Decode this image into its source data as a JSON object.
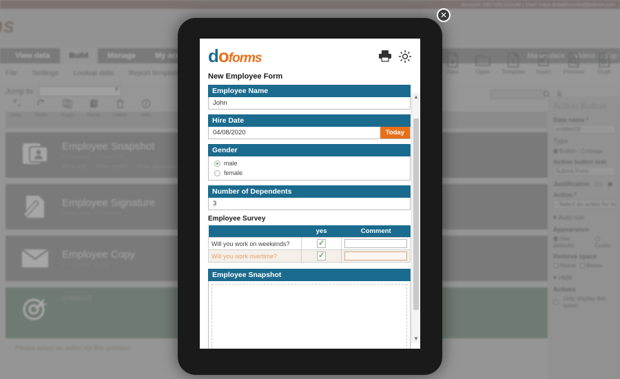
{
  "topbar": {
    "text": "Account  e807ofic102cd6   | User   maja.dutadinovska@yahoo.com"
  },
  "brand": {
    "logo_text": "ms"
  },
  "nav": {
    "tabs": [
      {
        "label": "View data",
        "active": false
      },
      {
        "label": "Build",
        "active": true
      },
      {
        "label": "Manage",
        "active": false
      },
      {
        "label": "My account",
        "active": false
      }
    ],
    "right_links": [
      "Marketplace",
      "Videos",
      "Sup"
    ]
  },
  "menubar": {
    "items": [
      "File",
      "Settings",
      "Lookup data",
      "Report templates"
    ]
  },
  "toolbar": {
    "items": [
      {
        "label": "New",
        "icon": "new-file-icon"
      },
      {
        "label": "Open",
        "icon": "folder-open-icon"
      },
      {
        "label": "Template",
        "icon": "template-icon"
      },
      {
        "label": "Insert",
        "icon": "insert-icon"
      },
      {
        "label": "Preview",
        "icon": "preview-icon"
      },
      {
        "label": "Draft",
        "icon": "draft-icon"
      }
    ]
  },
  "jumpbar": {
    "label": "Jump to",
    "select_value": "",
    "actions": [
      {
        "label": "Undo",
        "icon": "undo-icon"
      },
      {
        "label": "Redo",
        "icon": "redo-icon"
      },
      {
        "label": "Copy",
        "icon": "copy-icon"
      },
      {
        "label": "Paste",
        "icon": "paste-icon"
      },
      {
        "label": "Delete",
        "icon": "trash-icon"
      },
      {
        "label": "Help",
        "icon": "info-icon"
      }
    ],
    "search_placeholder": ""
  },
  "questions": [
    {
      "title": "Employee Snapshot",
      "subtitle": "Employee_Snapshot",
      "options": [
        "Allow edit",
        "Allow sketch",
        "Show advanced toolbar"
      ],
      "icon": "photo-id-icon",
      "selected": false
    },
    {
      "title": "Employee Signature",
      "subtitle": "Employee_Signature",
      "options": [],
      "icon": "signature-icon",
      "selected": false
    },
    {
      "title": "Employee Copy",
      "subtitle": "Employee_Copy",
      "options": [],
      "icon": "envelope-icon",
      "selected": false
    },
    {
      "title": "untitled15",
      "subtitle": "",
      "options": [],
      "icon": "target-action-icon",
      "selected": true
    }
  ],
  "warning": "Please select an action for this question",
  "row_controls": [
    "move-up-icon",
    "move-down-icon",
    "copy-icon",
    "delete-icon"
  ],
  "properties": {
    "title": "Action Button",
    "data_name_label": "Data name *",
    "data_name_value": "untitled15",
    "type_label": "Type",
    "type_options": [
      "Button",
      "Image"
    ],
    "type_selected": "Button",
    "action_text_label": "Action button text",
    "action_text_value": "Submit Form",
    "justification_label": "Justification",
    "justification_options": [
      "L",
      "C"
    ],
    "action_label": "Action *",
    "action_value": "- Select an action for bu",
    "auto_run_label": "Auto run",
    "appearance_label": "Appearance",
    "appearance_options": [
      "Use defaults",
      "Custo"
    ],
    "appearance_selected": "Use defaults",
    "remove_space_label": "Remove space",
    "remove_space_options": [
      "Above",
      "Below"
    ],
    "hide_label": "Hide",
    "actions_label": "Actions",
    "only_display_label": "Only display this quest"
  },
  "tablet": {
    "close_label": "✕",
    "logo": {
      "d": "d",
      "o": "o",
      "forms": "forms"
    },
    "header_icons": [
      "print-icon",
      "gear-icon"
    ],
    "form_title": "New Employee Form",
    "fields": [
      {
        "label": "Employee Name",
        "value": "John",
        "type": "text"
      },
      {
        "label": "Hire Date",
        "value": "04/08/2020",
        "type": "date",
        "button": "Today"
      },
      {
        "label": "Gender",
        "type": "radio",
        "options": [
          "male",
          "female"
        ],
        "selected": "male"
      },
      {
        "label": "Number of Dependents",
        "value": "3",
        "type": "text"
      }
    ],
    "survey": {
      "title": "Employee Survey",
      "columns": [
        "",
        "yes",
        "Comment"
      ],
      "rows": [
        {
          "question": "Will you work on weekends?",
          "yes": true,
          "comment": "",
          "highlight": false
        },
        {
          "question": "Will you work overtime?",
          "yes": true,
          "comment": "",
          "highlight": true
        }
      ]
    },
    "snapshot": {
      "label": "Employee Snapshot"
    }
  },
  "colors": {
    "field_header": "#1b6b8e",
    "accent_orange": "#e8701a",
    "selected_green": "#5d9a6b",
    "topbar": "#a97b6e"
  }
}
